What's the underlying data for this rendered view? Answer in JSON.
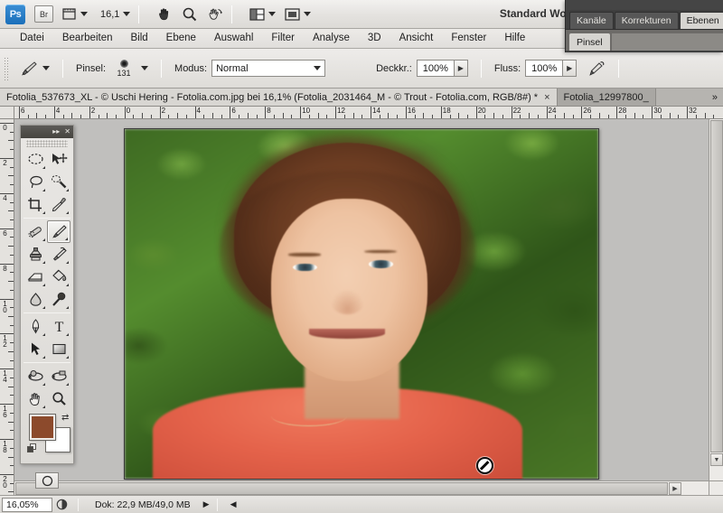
{
  "app": {
    "logo_text": "Ps",
    "bridge_label": "Br",
    "view_extras_icon": "view-extras-icon",
    "zoom_level": "16,1",
    "hand_icon": "hand-icon",
    "zoom_icon": "magnifier-icon",
    "rotate_view_icon": "rotate-view-icon",
    "arrange_documents_icon": "arrange-documents-icon",
    "screen_mode_icon": "screen-mode-icon",
    "workspace": "Standard Work"
  },
  "menu": {
    "items": [
      "Datei",
      "Bearbeiten",
      "Bild",
      "Ebene",
      "Auswahl",
      "Filter",
      "Analyse",
      "3D",
      "Ansicht",
      "Fenster",
      "Hilfe"
    ]
  },
  "options": {
    "tool_icon": "brush-tool-icon",
    "brush_label": "Pinsel:",
    "brush_size": "131",
    "mode_label": "Modus:",
    "mode_value": "Normal",
    "opacity_label": "Deckkr.:",
    "opacity_value": "100%",
    "flow_label": "Fluss:",
    "flow_value": "100%",
    "airbrush_icon": "airbrush-icon"
  },
  "tabs": {
    "active": "Fotolia_537673_XL - © Uschi Hering - Fotolia.com.jpg bei 16,1% (Fotolia_2031464_M - © Trout - Fotolia.com, RGB/8#) *",
    "close_glyph": "×",
    "inactive": "Fotolia_12997800_",
    "overflow": "»"
  },
  "rulers": {
    "unit": "cm",
    "horizontal_labels": [
      "6",
      "4",
      "2",
      "0",
      "2",
      "4",
      "6",
      "8",
      "10",
      "12",
      "14",
      "16",
      "18",
      "20",
      "22",
      "24",
      "26",
      "28",
      "30",
      "32"
    ],
    "vertical_labels": [
      "0",
      "2",
      "4",
      "6",
      "8",
      "10",
      "12",
      "14",
      "16",
      "18",
      "20"
    ]
  },
  "canvas": {
    "cursor_icon": "prohibited-cursor-icon",
    "image_description": "Portrait photo of a woman with curly red-brown hair, freckles, wearing a coral top, green foliage background"
  },
  "toolbox": {
    "collapse_icon": "collapse-arrows-icon",
    "close_icon": "close-icon",
    "tools": [
      {
        "name": "elliptical-marquee-tool",
        "glyph": "ellipse",
        "selected": false,
        "has_submenu": true
      },
      {
        "name": "move-tool",
        "glyph": "move",
        "selected": false,
        "has_submenu": false
      },
      {
        "name": "lasso-tool",
        "glyph": "lasso",
        "selected": false,
        "has_submenu": true
      },
      {
        "name": "magic-wand-tool",
        "glyph": "wand",
        "selected": false,
        "has_submenu": true
      },
      {
        "name": "crop-tool",
        "glyph": "crop",
        "selected": false,
        "has_submenu": true
      },
      {
        "name": "eyedropper-tool",
        "glyph": "eyedropper",
        "selected": false,
        "has_submenu": true
      },
      {
        "name": "healing-brush-tool",
        "glyph": "healing",
        "selected": false,
        "has_submenu": true
      },
      {
        "name": "brush-tool",
        "glyph": "brush",
        "selected": true,
        "has_submenu": true
      },
      {
        "name": "clone-stamp-tool",
        "glyph": "stamp",
        "selected": false,
        "has_submenu": true
      },
      {
        "name": "history-brush-tool",
        "glyph": "history-brush",
        "selected": false,
        "has_submenu": true
      },
      {
        "name": "eraser-tool",
        "glyph": "eraser",
        "selected": false,
        "has_submenu": true
      },
      {
        "name": "gradient-tool",
        "glyph": "paint-bucket",
        "selected": false,
        "has_submenu": true
      },
      {
        "name": "blur-tool",
        "glyph": "blur",
        "selected": false,
        "has_submenu": true
      },
      {
        "name": "dodge-tool",
        "glyph": "dodge",
        "selected": false,
        "has_submenu": true
      },
      {
        "name": "pen-tool",
        "glyph": "pen",
        "selected": false,
        "has_submenu": true
      },
      {
        "name": "type-tool",
        "glyph": "type",
        "selected": false,
        "has_submenu": true
      },
      {
        "name": "path-selection-tool",
        "glyph": "arrow",
        "selected": false,
        "has_submenu": true
      },
      {
        "name": "rectangle-shape-tool",
        "glyph": "rectangle",
        "selected": false,
        "has_submenu": true
      },
      {
        "name": "3d-rotate-tool",
        "glyph": "rotate-3d",
        "selected": false,
        "has_submenu": true
      },
      {
        "name": "3d-orbit-camera-tool",
        "glyph": "orbit-3d",
        "selected": false,
        "has_submenu": true
      },
      {
        "name": "hand-tool",
        "glyph": "hand",
        "selected": false,
        "has_submenu": true
      },
      {
        "name": "zoom-tool",
        "glyph": "magnifier",
        "selected": false,
        "has_submenu": false
      }
    ],
    "foreground_color": "#8c4a2c",
    "background_color": "#ffffff",
    "swap_colors_icon": "swap-colors-icon",
    "default_colors_icon": "default-colors-icon",
    "quick_mask_icon": "quick-mask-icon"
  },
  "panels": {
    "row1": [
      {
        "label": "Kanäle",
        "active": false
      },
      {
        "label": "Korrekturen",
        "active": false
      },
      {
        "label": "Ebenen",
        "active": true
      }
    ],
    "row2": [
      {
        "label": "Pinsel",
        "active": true
      }
    ]
  },
  "status": {
    "zoom": "16,05%",
    "preview_icon": "preview-icon",
    "info": "Dok: 22,9 MB/49,0 MB",
    "arrow_glyph": "▶"
  }
}
